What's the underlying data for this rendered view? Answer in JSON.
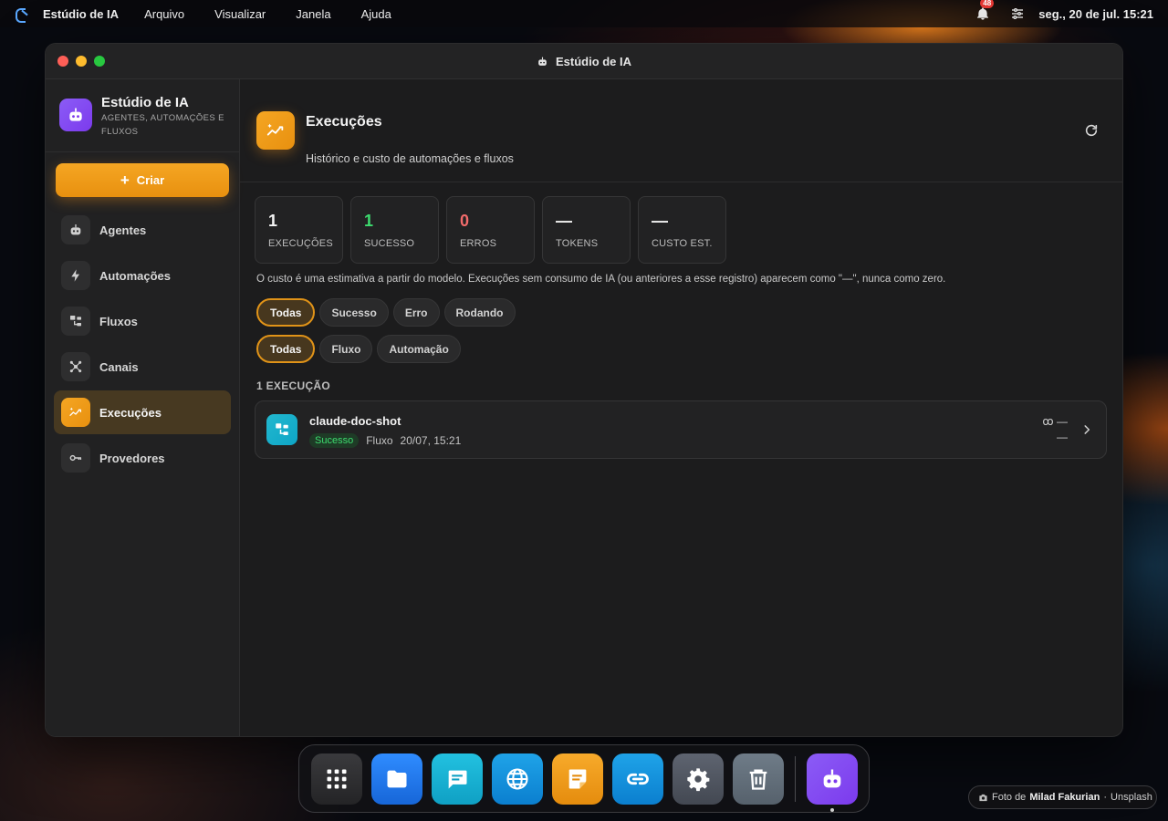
{
  "menubar": {
    "app_name": "Estúdio de IA",
    "menus": [
      "Arquivo",
      "Visualizar",
      "Janela",
      "Ajuda"
    ],
    "notification_count": "48",
    "clock": "seg., 20 de jul. 15:21"
  },
  "window": {
    "title": "Estúdio de IA"
  },
  "sidebar": {
    "brand_name": "Estúdio de IA",
    "brand_sub": "AGENTES, AUTOMAÇÕES E FLUXOS",
    "create_label": "Criar",
    "items": [
      {
        "label": "Agentes",
        "icon": "robot-icon"
      },
      {
        "label": "Automações",
        "icon": "bolt-icon"
      },
      {
        "label": "Fluxos",
        "icon": "flow-icon"
      },
      {
        "label": "Canais",
        "icon": "hub-icon"
      },
      {
        "label": "Execuções",
        "icon": "sparkline-icon",
        "active": true
      },
      {
        "label": "Provedores",
        "icon": "key-icon"
      }
    ]
  },
  "main": {
    "title": "Execuções",
    "subtitle": "Histórico e custo de automações e fluxos",
    "stats": [
      {
        "value": "1",
        "label": "EXECUÇÕES",
        "color": "#f4f4f4"
      },
      {
        "value": "1",
        "label": "SUCESSO",
        "color": "#3ddc6f"
      },
      {
        "value": "0",
        "label": "ERROS",
        "color": "#f26b6b"
      },
      {
        "value": "—",
        "label": "TOKENS",
        "color": "#f4f4f4"
      },
      {
        "value": "—",
        "label": "CUSTO EST.",
        "color": "#f4f4f4"
      }
    ],
    "note": "O custo é uma estimativa a partir do modelo. Execuções sem consumo de IA (ou anteriores a esse registro) aparecem como \"—\", nunca como zero.",
    "status_filters": [
      "Todas",
      "Sucesso",
      "Erro",
      "Rodando"
    ],
    "type_filters": [
      "Todas",
      "Fluxo",
      "Automação"
    ],
    "count_label": "1 EXECUÇÃO",
    "executions": [
      {
        "name": "claude-doc-shot",
        "status": "Sucesso",
        "type": "Fluxo",
        "time": "20/07, 15:21",
        "tokens": "—",
        "cost": "—"
      }
    ]
  },
  "dock": {
    "apps": [
      "apps-grid-icon",
      "files-icon",
      "messages-icon",
      "browser-icon",
      "notes-icon",
      "links-icon",
      "settings-icon",
      "trash-icon",
      "ai-studio-icon"
    ]
  },
  "credit": {
    "prefix": "Foto de",
    "author": "Milad Fakurian",
    "source": "Unsplash"
  },
  "colors": {
    "accent": "#f5a623",
    "brand": "#8b5cf6",
    "success": "#3ddc6f",
    "error": "#f26b6b"
  }
}
